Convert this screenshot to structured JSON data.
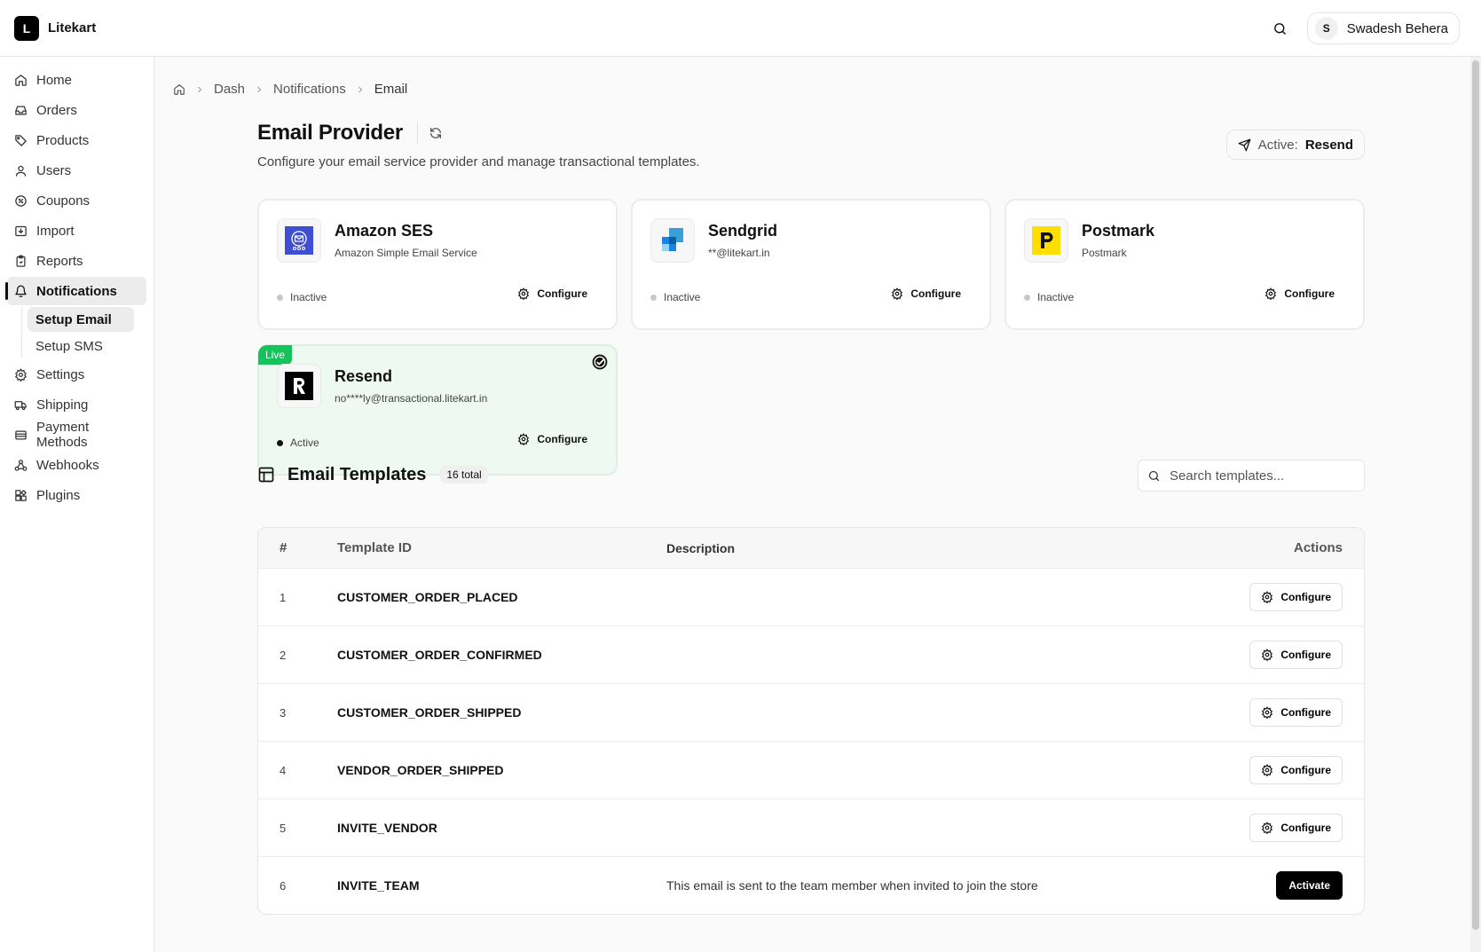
{
  "app": {
    "logo_letter": "L",
    "name": "Litekart"
  },
  "header": {
    "user_initial": "S",
    "user_name": "Swadesh Behera"
  },
  "sidebar": {
    "items": [
      {
        "label": "Home",
        "icon": "home-icon"
      },
      {
        "label": "Orders",
        "icon": "inbox-icon"
      },
      {
        "label": "Products",
        "icon": "tag-icon"
      },
      {
        "label": "Users",
        "icon": "user-icon"
      },
      {
        "label": "Coupons",
        "icon": "coupon-icon"
      },
      {
        "label": "Import",
        "icon": "import-icon"
      },
      {
        "label": "Reports",
        "icon": "clipboard-icon"
      },
      {
        "label": "Notifications",
        "icon": "bell-icon"
      },
      {
        "label": "Settings",
        "icon": "gear-icon"
      },
      {
        "label": "Shipping",
        "icon": "truck-icon"
      },
      {
        "label": "Payment Methods",
        "icon": "wallet-icon"
      },
      {
        "label": "Webhooks",
        "icon": "webhook-icon"
      },
      {
        "label": "Plugins",
        "icon": "puzzle-icon"
      }
    ],
    "sub_items": [
      {
        "label": "Setup Email"
      },
      {
        "label": "Setup SMS"
      }
    ]
  },
  "breadcrumb": {
    "items": [
      "Dash",
      "Notifications",
      "Email"
    ]
  },
  "page": {
    "title": "Email Provider",
    "subtitle": "Configure your email service provider and manage transactional templates.",
    "active_label": "Active:",
    "active_value": "Resend"
  },
  "providers": [
    {
      "name": "Amazon SES",
      "desc": "Amazon Simple Email Service",
      "status": "Inactive",
      "action": "Configure"
    },
    {
      "name": "Sendgrid",
      "desc": "**@litekart.in",
      "status": "Inactive",
      "action": "Configure"
    },
    {
      "name": "Postmark",
      "desc": "Postmark",
      "status": "Inactive",
      "action": "Configure"
    },
    {
      "name": "Resend",
      "desc": "no****ly@transactional.litekart.in",
      "status": "Active",
      "action": "Configure",
      "badge": "Live"
    }
  ],
  "templates": {
    "title": "Email Templates",
    "count": "16 total",
    "search_placeholder": "Search templates...",
    "columns": [
      "#",
      "Template ID",
      "Description",
      "Actions"
    ],
    "rows": [
      {
        "num": "1",
        "id": "CUSTOMER_ORDER_PLACED",
        "desc": "",
        "action": "Configure"
      },
      {
        "num": "2",
        "id": "CUSTOMER_ORDER_CONFIRMED",
        "desc": "",
        "action": "Configure"
      },
      {
        "num": "3",
        "id": "CUSTOMER_ORDER_SHIPPED",
        "desc": "",
        "action": "Configure"
      },
      {
        "num": "4",
        "id": "VENDOR_ORDER_SHIPPED",
        "desc": "",
        "action": "Configure"
      },
      {
        "num": "5",
        "id": "INVITE_VENDOR",
        "desc": "",
        "action": "Configure"
      },
      {
        "num": "6",
        "id": "INVITE_TEAM",
        "desc": "This email is sent to the team member when invited to join the store",
        "action": "Activate"
      }
    ]
  },
  "colors": {
    "live_green": "#16c35a",
    "live_card_bg": "#eefaf1",
    "accent": "#000000"
  }
}
